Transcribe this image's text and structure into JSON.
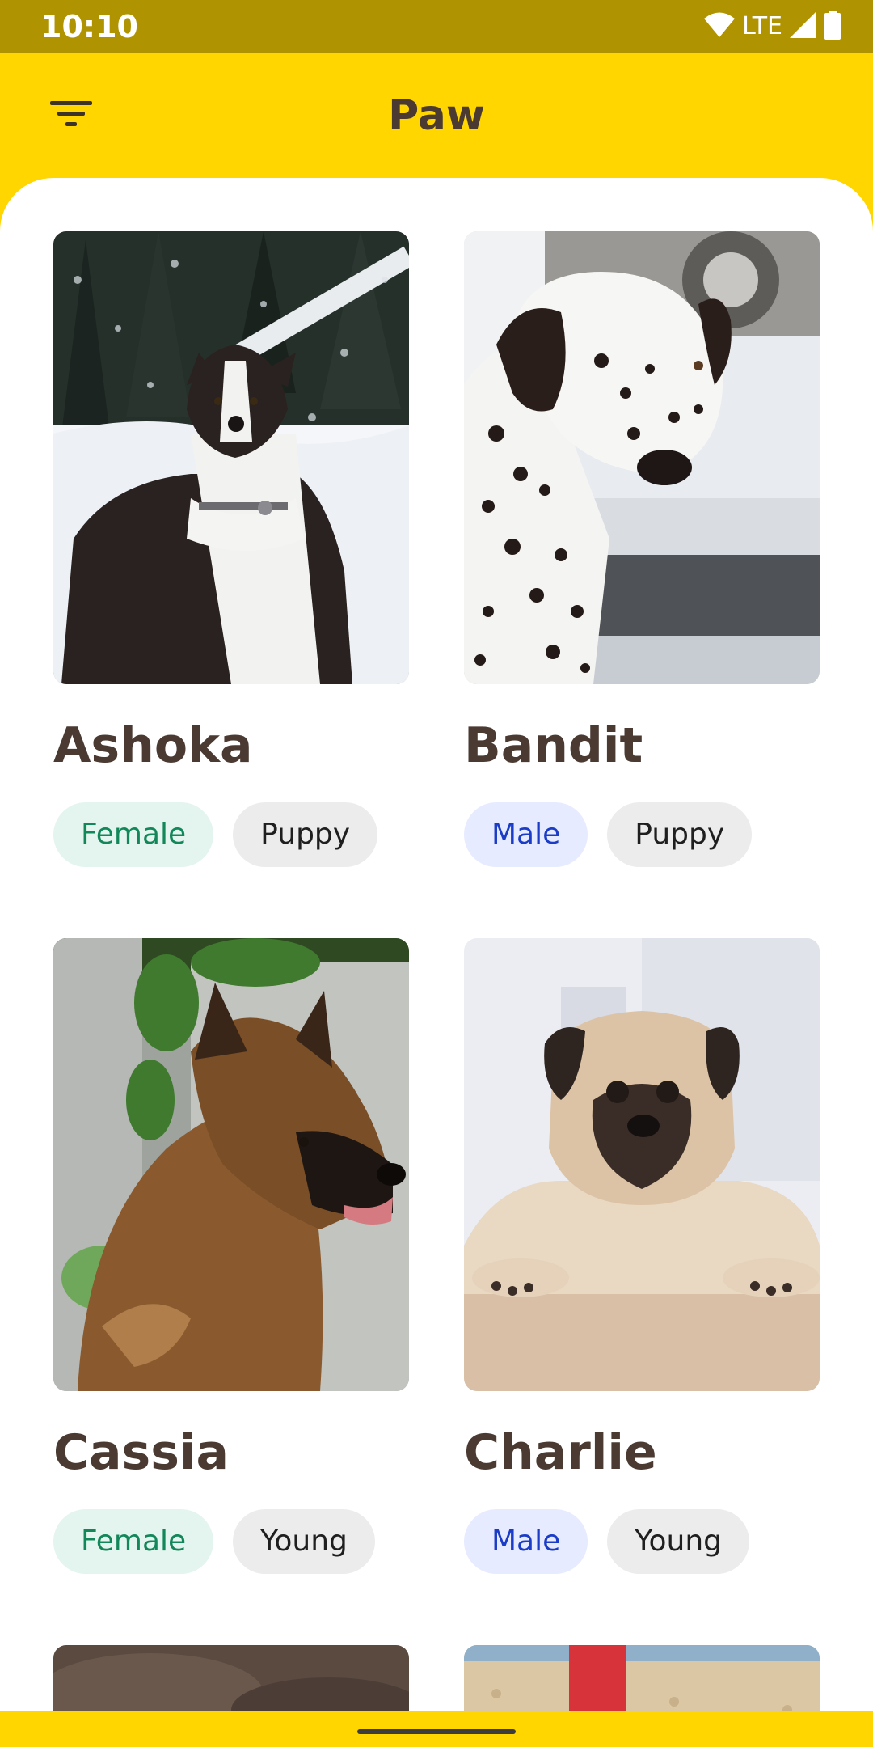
{
  "status_bar": {
    "time": "10:10",
    "network": "LTE",
    "icons": [
      "wifi-icon",
      "signal-icon",
      "battery-icon"
    ]
  },
  "app_bar": {
    "title": "Paw",
    "filter_icon": "filter-icon"
  },
  "colors": {
    "app_bar": "#FFD600",
    "status_bar": "#B09300",
    "name_text": "#4A3A32",
    "female_chip_bg": "#E3F5EE",
    "female_chip_text": "#12875A",
    "male_chip_bg": "#E6EBFF",
    "male_chip_text": "#1A3CC7",
    "age_chip_bg": "#ECECEC"
  },
  "pets": [
    {
      "name": "Ashoka",
      "gender": "Female",
      "age": "Puppy",
      "photo": "border-collie-in-snow"
    },
    {
      "name": "Bandit",
      "gender": "Male",
      "age": "Puppy",
      "photo": "dalmatian"
    },
    {
      "name": "Cassia",
      "gender": "Female",
      "age": "Young",
      "photo": "german-shepherd"
    },
    {
      "name": "Charlie",
      "gender": "Male",
      "age": "Young",
      "photo": "pug"
    }
  ]
}
